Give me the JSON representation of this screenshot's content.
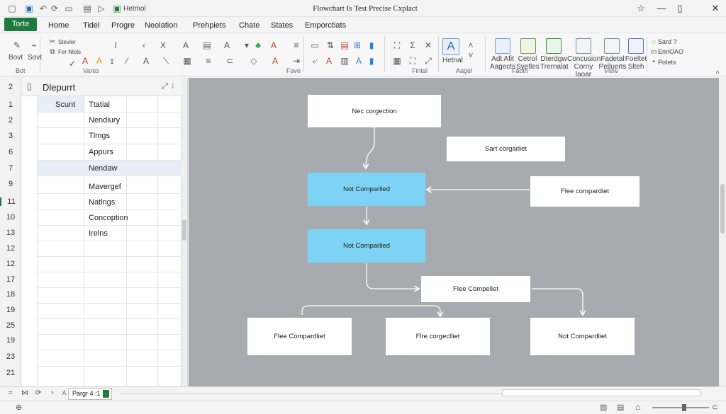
{
  "window": {
    "title": "Flowchart Is Test Precise Cxplact",
    "doc_name": "Hetmol",
    "quick_access_icons": [
      "app-icon",
      "save-icon",
      "undo-icon",
      "redo-icon",
      "new-icon",
      "print-icon",
      "forward-icon",
      "sheet-icon"
    ],
    "controls": [
      "star-icon",
      "minimize-icon",
      "restore-icon",
      "close-icon"
    ],
    "accent": "#1e7a3e"
  },
  "menu": {
    "file_tab": "Torte",
    "tabs": [
      "Home",
      "Tidel",
      "Progre",
      "Neolation",
      "Prehpiets",
      "Chate",
      "States",
      "Emporctiats"
    ]
  },
  "ribbon": {
    "left_buttons": [
      {
        "label": "Bovt"
      },
      {
        "label": "Sovt"
      }
    ],
    "small_texts": [
      "Stevler",
      "Fer Nlols"
    ],
    "groups": [
      "Bot",
      "Vares",
      "Fave",
      "Fintal",
      "Aagel",
      "Faoth",
      "Vlew"
    ],
    "big_buttons": [
      {
        "label": "Hetnal"
      },
      {
        "label": "Adt Afit Aagects"
      },
      {
        "label": "Cetrol Syetles"
      },
      {
        "label": "Dterdgw Trernalat"
      },
      {
        "label": "Concusion Corny laoar"
      },
      {
        "label": "Fadetal Pelluerts"
      },
      {
        "label": "Foeltet Slteh"
      }
    ],
    "right_items": [
      "Sard ?",
      "EnnOAO",
      "Potets"
    ]
  },
  "left_panel": {
    "title": "Dlepurrt",
    "header_row_num": "2",
    "row_numbers": [
      "1",
      "2",
      "3",
      "6",
      "7",
      "9",
      "11",
      "10",
      "13",
      "12",
      "12",
      "17",
      "18",
      "19",
      "25",
      "19",
      "23",
      "21"
    ],
    "rows": [
      {
        "col1": "Scunt",
        "col2": "Ttatial"
      },
      {
        "col1": "",
        "col2": "Nendiury"
      },
      {
        "col1": "",
        "col2": "Tlmgs"
      },
      {
        "col1": "",
        "col2": "Appurs"
      },
      {
        "col1": "",
        "col2": "Nendaw"
      },
      {
        "col1": "",
        "col2": "Mavergef"
      },
      {
        "col1": "",
        "col2": "Natlngs"
      },
      {
        "col1": "",
        "col2": "Concoption"
      },
      {
        "col1": "",
        "col2": "Irelns"
      }
    ]
  },
  "flowchart": {
    "highlight_color": "#7dd3f4",
    "nodes": [
      {
        "id": "n1",
        "label": "Nec corgection"
      },
      {
        "id": "n2",
        "label": "Sart corgarliet"
      },
      {
        "id": "n3",
        "label": "Not Comparlied"
      },
      {
        "id": "n4",
        "label": "Flee compardiet"
      },
      {
        "id": "n5",
        "label": "Not Comparlied"
      },
      {
        "id": "n6",
        "label": "Flee Compellet"
      },
      {
        "id": "n7",
        "label": "Flee Compardliet"
      },
      {
        "id": "n8",
        "label": "Flre corgeclliet"
      },
      {
        "id": "n9",
        "label": "Not Compardliet"
      }
    ]
  },
  "sheetbar": {
    "sheet_tab": "Pargr 4 :1"
  }
}
